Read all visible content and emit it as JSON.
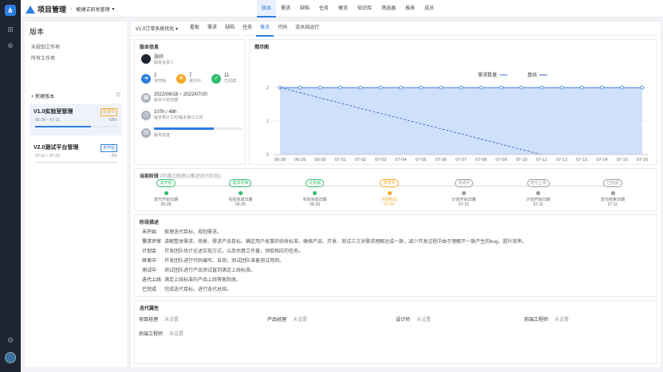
{
  "app": {
    "title": "项目管理",
    "project": "敏捷式研发管理"
  },
  "topnav": [
    "版本",
    "需求",
    "缺陷",
    "任务",
    "概览",
    "知识库",
    "筛选器",
    "报表",
    "成员"
  ],
  "sidebar": {
    "heading": "版本",
    "links": [
      "未规划工作项",
      "所有工作项"
    ],
    "new_label": "新建版本",
    "versions": [
      {
        "name": "V1.0实验室管理",
        "dates": "06-28 ~ 07-11",
        "percent": "68%",
        "status": "研发中",
        "progress": 0.68,
        "selected": true
      },
      {
        "name": "V2.0测试平台管理",
        "dates": "07-11 ~ 07-23",
        "percent": "0%",
        "status": "未开始",
        "progress": 0,
        "selected": false
      }
    ]
  },
  "tabs": {
    "version": "V1.0订单系统优化",
    "items": [
      "看板",
      "需求",
      "缺陷",
      "任务",
      "概览",
      "代码",
      "流水线运行"
    ],
    "active": 4
  },
  "info": {
    "title": "版本信息",
    "owner": "张好",
    "owner_label": "版本负责人",
    "stats": [
      {
        "n": "2",
        "l": "未开始",
        "c": "#2f7de1",
        "i": "➜"
      },
      {
        "n": "7",
        "l": "进行中",
        "c": "#f5a623",
        "i": "✲"
      },
      {
        "n": "11",
        "l": "已完成",
        "c": "#2ebd6b",
        "i": "✓"
      }
    ],
    "date_range": "2022/06/18 ~ 2022/07/20",
    "date_label": "版本计划日期",
    "hours": "107h / 48h",
    "hours_label": "版本预计工时/版本累计工时",
    "progress_label": "版本进度",
    "progress": 0.68
  },
  "chart_data": {
    "type": "line",
    "title": "燃尽图",
    "legend": [
      "需求数量",
      "基线"
    ],
    "x": [
      "06-28",
      "06-29",
      "06-30",
      "07-01",
      "07-02",
      "07-03",
      "07-04",
      "07-05",
      "07-06",
      "07-07",
      "07-08",
      "07-09",
      "07-10",
      "07-11",
      "07-12",
      "07-13",
      "07-14",
      "07-15",
      "07-16"
    ],
    "series": [
      {
        "name": "需求数量",
        "values": [
          2,
          2,
          2,
          2,
          2,
          2,
          2,
          2,
          2,
          2,
          2,
          2,
          2,
          2,
          2,
          2,
          2,
          2,
          2
        ]
      },
      {
        "name": "基线",
        "values": [
          2,
          1.85,
          1.69,
          1.54,
          1.38,
          1.23,
          1.08,
          0.92,
          0.77,
          0.62,
          0.46,
          0.31,
          0.15,
          0,
          null,
          null,
          null,
          null,
          null
        ]
      }
    ],
    "yticks": [
      "0",
      "1",
      "2"
    ],
    "ylim": [
      0,
      2
    ]
  },
  "stages": {
    "title": "当前阶段",
    "hint": "(可通过拖拽以推进迭代阶段)",
    "items": [
      {
        "chip": "未开始",
        "l1": "迭代开始日期",
        "l2": "06-28",
        "c": "#2ebd6b"
      },
      {
        "chip": "需求评审",
        "l1": "实际完成日期",
        "l2": "06-28",
        "c": "#2ebd6b"
      },
      {
        "chip": "计划会",
        "l1": "实际完成日期",
        "l2": "06-29",
        "c": "#2ebd6b"
      },
      {
        "chip": "研发中",
        "l1": "当前阶段",
        "l2": "07-29",
        "c": "#f5a623"
      },
      {
        "chip": "测试中",
        "l1": "计划开始日期",
        "l2": "07-10",
        "c": "#999"
      },
      {
        "chip": "迭代上线",
        "l1": "计划开始日期",
        "l2": "07-11",
        "c": "#999"
      },
      {
        "chip": "已完成",
        "l1": "迭代结束日期",
        "l2": "07-11",
        "c": "#999"
      }
    ]
  },
  "desc": {
    "title": "阶段描述",
    "rows": [
      [
        "未开始",
        "梳理迭代目标、规划需求。"
      ],
      [
        "需求评审",
        "讲解整体需求、场景、需求产品目标、确定用户故事的验收标准，确保产品、开发、测试三方对需求理解达成一致，减少开发过程中由于理解不一致产生的bug，提升效率。"
      ],
      [
        "计划会",
        "开发团队估计论述实现方式，以及估算工作量，领取相应的任务。"
      ],
      [
        "研发中",
        "开发团队进行代码编写、自测，测试团队准备测试用例。"
      ],
      [
        "测试中",
        "测试团队进行产品测试直到满足上线标准。"
      ],
      [
        "迭代上线",
        "满足上线标准的产品上线等客制发。"
      ],
      [
        "已完成",
        "完成迭代目标，进行迭代总结。"
      ]
    ]
  },
  "attrs": {
    "title": "迭代属性",
    "items": [
      [
        "项目经理",
        "未设置"
      ],
      [
        "产品经理",
        "未设置"
      ],
      [
        "设计师",
        "未设置"
      ],
      [
        "前端工程师",
        "未设置"
      ],
      [
        "后端工程师",
        "未设置"
      ]
    ]
  }
}
